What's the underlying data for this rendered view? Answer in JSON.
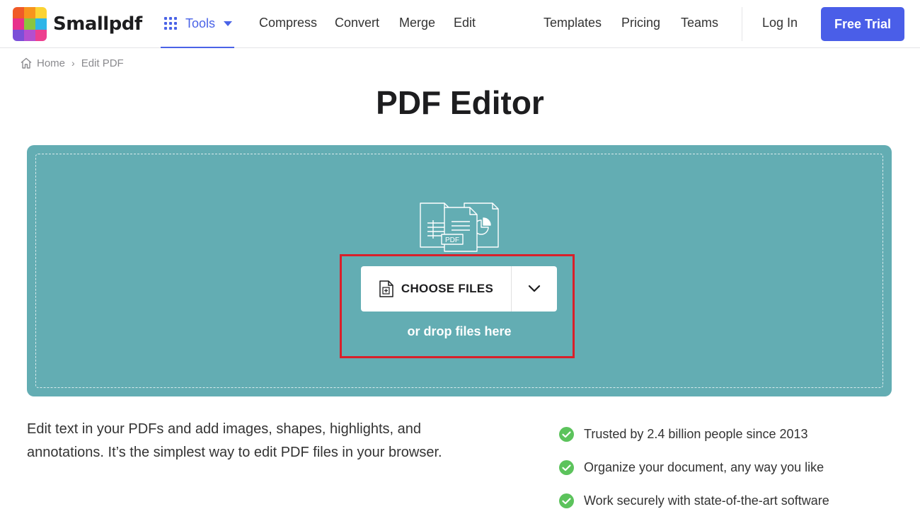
{
  "brand": {
    "name": "Smallpdf",
    "logo_colors": [
      "#f05a28",
      "#f7941d",
      "#fbb034",
      "#e8308c",
      "#8bc53f",
      "#00aeef",
      "#7b4fd8",
      "#b44fd0",
      "#ed3f8f"
    ]
  },
  "nav": {
    "tools_label": "Tools",
    "links": [
      "Compress",
      "Convert",
      "Merge",
      "Edit",
      "Templates",
      "Pricing",
      "Teams"
    ],
    "login": "Log In",
    "free_trial": "Free Trial"
  },
  "breadcrumb": {
    "home": "Home",
    "separator": "›",
    "current": "Edit PDF"
  },
  "page_title": "PDF Editor",
  "upload": {
    "illustration_badge": "PDF",
    "choose_files": "CHOOSE FILES",
    "drop_text": "or drop files here"
  },
  "description": "Edit text in your PDFs and add images, shapes, highlights, and annotations. It’s the simplest way to edit PDF files in your browser.",
  "features": [
    "Trusted by 2.4 billion people since 2013",
    "Organize your document, any way you like",
    "Work securely with state-of-the-art software"
  ],
  "colors": {
    "accent": "#4a63e7",
    "cta": "#4a5ee8",
    "dropzone": "#63adb3",
    "highlight": "#d9202a",
    "check": "#5cc35c"
  }
}
